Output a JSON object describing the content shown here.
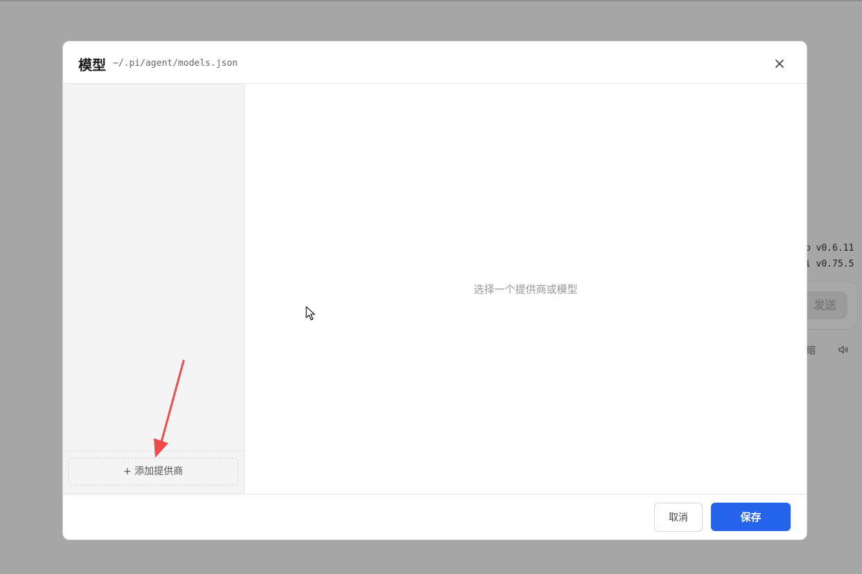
{
  "background": {
    "version_line_1": "p v0.6.11",
    "version_line_2": "i v0.75.5",
    "send_label": "发送",
    "compress_label": "缩",
    "speaker_icon": "speaker-icon"
  },
  "dialog": {
    "title": "模型",
    "path": "~/.pi/agent/models.json",
    "close_icon": "close-icon",
    "sidebar": {
      "add_provider_label": "+ 添加提供商"
    },
    "main": {
      "empty_hint": "选择一个提供商或模型"
    },
    "footer": {
      "cancel_label": "取消",
      "save_label": "保存"
    }
  },
  "colors": {
    "primary": "#2563eb",
    "overlay": "#a6a6a6",
    "annotation_arrow": "#f04b4b"
  }
}
